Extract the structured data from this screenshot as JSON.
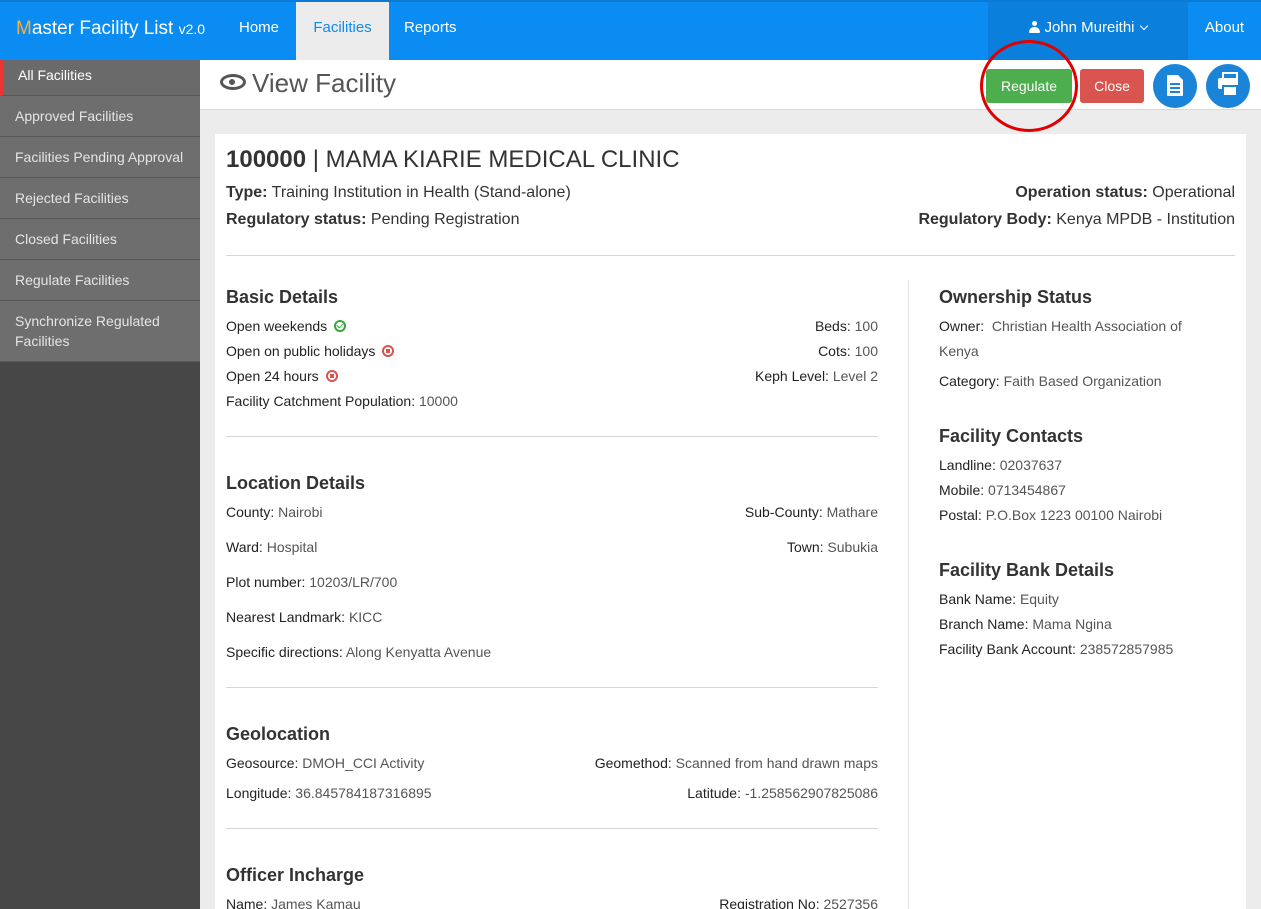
{
  "navbar": {
    "brand_initial": "M",
    "brand_rest": "aster Facility List",
    "brand_version": "v2.0",
    "home": "Home",
    "facilities": "Facilities",
    "reports": "Reports",
    "user": "John Mureithi",
    "about": "About"
  },
  "sidebar": {
    "items": [
      {
        "label": "All Facilities"
      },
      {
        "label": "Approved Facilities"
      },
      {
        "label": "Facilities Pending Approval"
      },
      {
        "label": "Rejected Facilities"
      },
      {
        "label": "Closed Facilities"
      },
      {
        "label": "Regulate Facilities"
      },
      {
        "label": "Synchronize Regulated Facilities"
      }
    ]
  },
  "header": {
    "title": "View Facility",
    "regulate": "Regulate",
    "close": "Close"
  },
  "facility": {
    "code": "100000",
    "separator": " | ",
    "name": "MAMA KIARIE MEDICAL CLINIC",
    "type_label": "Type:",
    "type": "Training Institution in Health (Stand-alone)",
    "regstatus_label": "Regulatory status:",
    "regstatus": "Pending Registration",
    "opstatus_label": "Operation status:",
    "opstatus": "Operational",
    "regbody_label": "Regulatory Body:",
    "regbody": "Kenya MPDB - Institution"
  },
  "basic": {
    "heading": "Basic Details",
    "weekends": "Open weekends",
    "holidays": "Open on public holidays",
    "hours24": "Open 24 hours",
    "catchment_label": "Facility Catchment Population:",
    "catchment": "10000",
    "beds_label": "Beds:",
    "beds": "100",
    "cots_label": "Cots:",
    "cots": "100",
    "keph_label": "Keph Level:",
    "keph": "Level 2"
  },
  "location": {
    "heading": "Location Details",
    "county_label": "County:",
    "county": "Nairobi",
    "subcounty_label": "Sub-County:",
    "subcounty": "Mathare",
    "ward_label": "Ward:",
    "ward": "Hospital",
    "town_label": "Town:",
    "town": "Subukia",
    "plot_label": "Plot number:",
    "plot": "10203/LR/700",
    "landmark_label": "Nearest Landmark:",
    "landmark": "KICC",
    "directions_label": "Specific directions:",
    "directions": "Along Kenyatta Avenue"
  },
  "geo": {
    "heading": "Geolocation",
    "source_label": "Geosource:",
    "source": "DMOH_CCI Activity",
    "method_label": "Geomethod:",
    "method": "Scanned from hand drawn maps",
    "lon_label": "Longitude:",
    "lon": "36.845784187316895",
    "lat_label": "Latitude:",
    "lat": "-1.258562907825086"
  },
  "officer": {
    "heading": "Officer Incharge",
    "name_label": "Name:",
    "name": "James Kamau",
    "reg_label": "Registration No:",
    "reg": "2527356"
  },
  "ownership": {
    "heading": "Ownership Status",
    "owner_label": "Owner:",
    "owner_line1": "Christian Health Association of",
    "owner_line2": "Kenya",
    "category_label": "Category:",
    "category": "Faith Based Organization"
  },
  "contacts": {
    "heading": "Facility Contacts",
    "landline_label": "Landline:",
    "landline": "02037637",
    "mobile_label": "Mobile:",
    "mobile": "0713454867",
    "postal_label": "Postal:",
    "postal": "P.O.Box 1223 00100 Nairobi"
  },
  "bank": {
    "heading": "Facility Bank Details",
    "name_label": "Bank Name:",
    "name": "Equity",
    "branch_label": "Branch Name:",
    "branch": "Mama Ngina",
    "account_label": "Facility Bank Account:",
    "account": "238572857985"
  }
}
